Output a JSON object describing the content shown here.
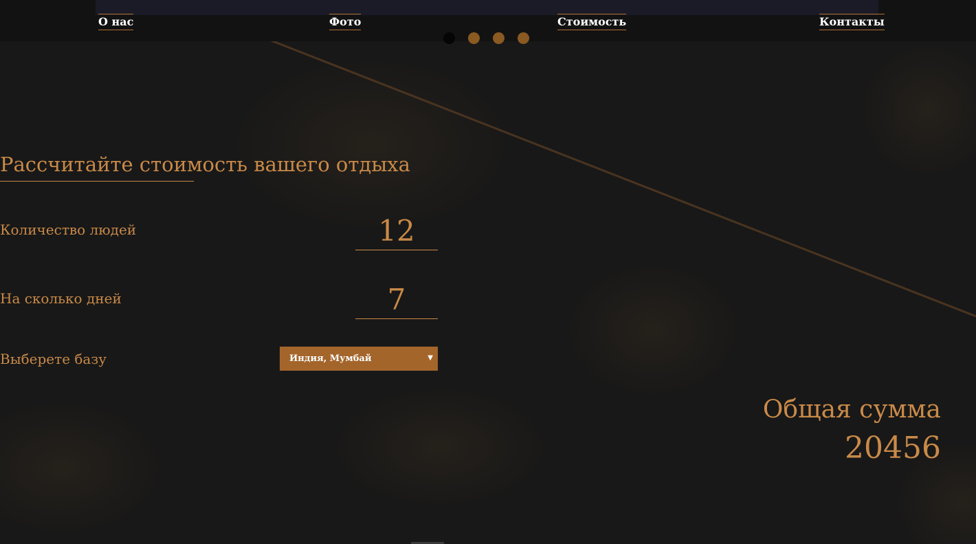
{
  "nav": {
    "items": [
      {
        "label": "О нас"
      },
      {
        "label": "Фото"
      },
      {
        "label": "Стоимость"
      },
      {
        "label": "Контакты"
      }
    ]
  },
  "slider": {
    "dot_count": 4,
    "active_index": 0
  },
  "calculator": {
    "title": "Рассчитайте стоимость вашего отдыха",
    "people": {
      "label": "Количество людей",
      "value": "12"
    },
    "days": {
      "label": "На сколько дней",
      "value": "7"
    },
    "base": {
      "label": "Выберете базу",
      "selected": "Индия, Мумбай"
    }
  },
  "total": {
    "label": "Общая сумма",
    "value": "20456"
  },
  "colors": {
    "accent": "#c98a48",
    "select_bg": "#a4652a",
    "background": "#181818",
    "header_bg": "#121212"
  }
}
